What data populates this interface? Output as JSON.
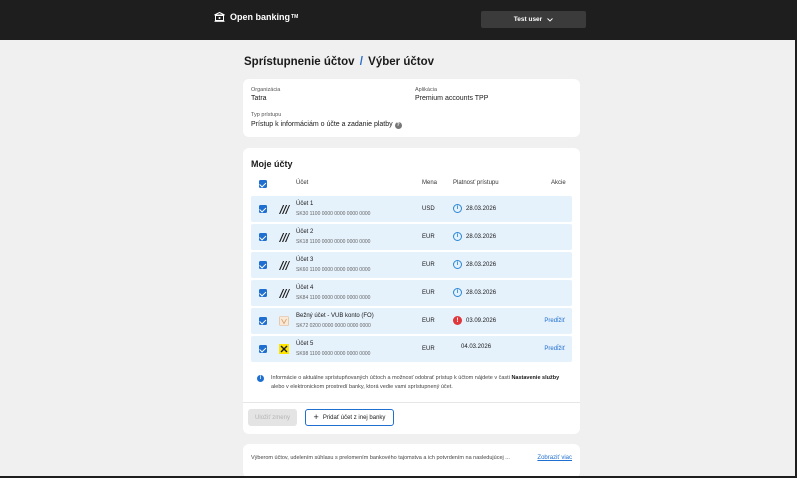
{
  "header": {
    "logo_text": "Open banking",
    "logo_tm": "TM",
    "user_button_label": "Test user"
  },
  "page": {
    "title_part1": "Sprístupnenie účtov",
    "title_separator": "/",
    "title_part2": "Výber účtov"
  },
  "info": {
    "organization_label": "Organizácia",
    "organization_value": "Tatra",
    "application_label": "Aplikácia",
    "application_value": "Premium accounts TPP",
    "access_type_label": "Typ prístupu",
    "access_type_value": "Prístup k informáciám o účte a zadanie platby",
    "help_glyph": "?"
  },
  "accounts": {
    "title": "Moje účty",
    "columns": {
      "account": "Účet",
      "currency": "Mena",
      "validity": "Platnosť prístupu",
      "actions": "Akcie"
    },
    "rows": [
      {
        "name": "Účet 1",
        "iban": "SK30 1100 0000 0000 0000 0000",
        "currency": "USD",
        "validity": "28.03.2026",
        "status": "info",
        "icon": "tatra-bank-icon",
        "action": ""
      },
      {
        "name": "Účet 2",
        "iban": "SK18 1100 0000 0000 0000 0000",
        "currency": "EUR",
        "validity": "28.03.2026",
        "status": "info",
        "icon": "tatra-bank-icon",
        "action": ""
      },
      {
        "name": "Účet 3",
        "iban": "SK60 1100 0000 0000 0000 0000",
        "currency": "EUR",
        "validity": "28.03.2026",
        "status": "info",
        "icon": "tatra-bank-icon",
        "action": ""
      },
      {
        "name": "Účet 4",
        "iban": "SK84 1100 0000 0000 0000 0000",
        "currency": "EUR",
        "validity": "28.03.2026",
        "status": "info",
        "icon": "tatra-bank-icon",
        "action": ""
      },
      {
        "name": "Bežný účet - VUB konto (FO)",
        "iban": "SK72 0200 0000 0000 0000 0000",
        "currency": "EUR",
        "validity": "03.09.2026",
        "status": "warning",
        "icon": "vub-bank-icon",
        "action": "Predĺžiť"
      },
      {
        "name": "Účet 5",
        "iban": "SK98 1100 0000 0000 0000 0000",
        "currency": "EUR",
        "validity": "04.03.2026",
        "status": "none",
        "icon": "raiffeisen-bank-icon",
        "action": "Predĺžiť"
      }
    ],
    "note_prefix": "Informácie o aktuálne sprístupňovaných účtoch a možnosť odobrať prístup k účtom nájdete v časti ",
    "note_bold": "Nastavenie služby",
    "note_suffix": " alebo v elektronickom prostredí banky, ktorá vedie vami sprístupnený účet.",
    "info_glyph": "i",
    "warning_glyph": "!",
    "save_button": "Uložiť zmeny",
    "add_button": "Pridať účet z inej banky",
    "add_glyph": "+"
  },
  "footer": {
    "text": "Výberom účtov, udelením súhlasu s prelomením bankového tajomstva a ich potvrdením na nasledujúcej ...",
    "link": "Zobraziť viac"
  },
  "colors": {
    "accent": "#1f6fd1",
    "topbar": "#1e1e1e",
    "row_bg": "#e5f1fb",
    "warning": "#e0373b"
  }
}
